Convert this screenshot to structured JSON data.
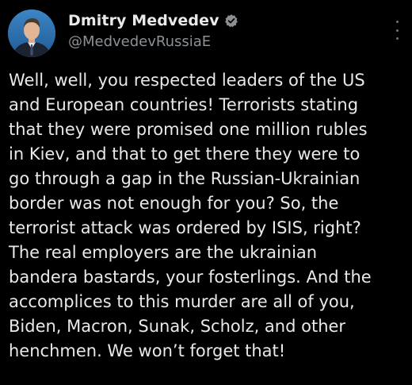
{
  "author": {
    "display_name": "Dmitry Medvedev",
    "handle": "@MedvedevRussiaE",
    "verified_icon": "verified-badge-icon",
    "avatar_icon": "profile-avatar"
  },
  "menu": {
    "icon": "more-options-icon"
  },
  "tweet": {
    "lines": [
      "Well, well, you respected leaders of the US",
      "and European countries! Terrorists stating",
      "that they were promised one million rubles",
      "in Kiev, and that to get there they were to",
      "go through a gap in the Russian-Ukrainian",
      "border was not enough for you? So, the",
      "terrorist attack was ordered by ISIS, right?",
      "The real employers are the ukrainian",
      "bandera bastards, your fosterlings. And the",
      "accomplices to this murder are all of you,",
      "Biden, Macron, Sunak, Scholz, and other",
      "henchmen. We won’t forget that!"
    ]
  },
  "colors": {
    "background": "#000000",
    "text": "#e7e9ea",
    "secondary_text": "#8b9196",
    "verified": "#8a8f94"
  }
}
